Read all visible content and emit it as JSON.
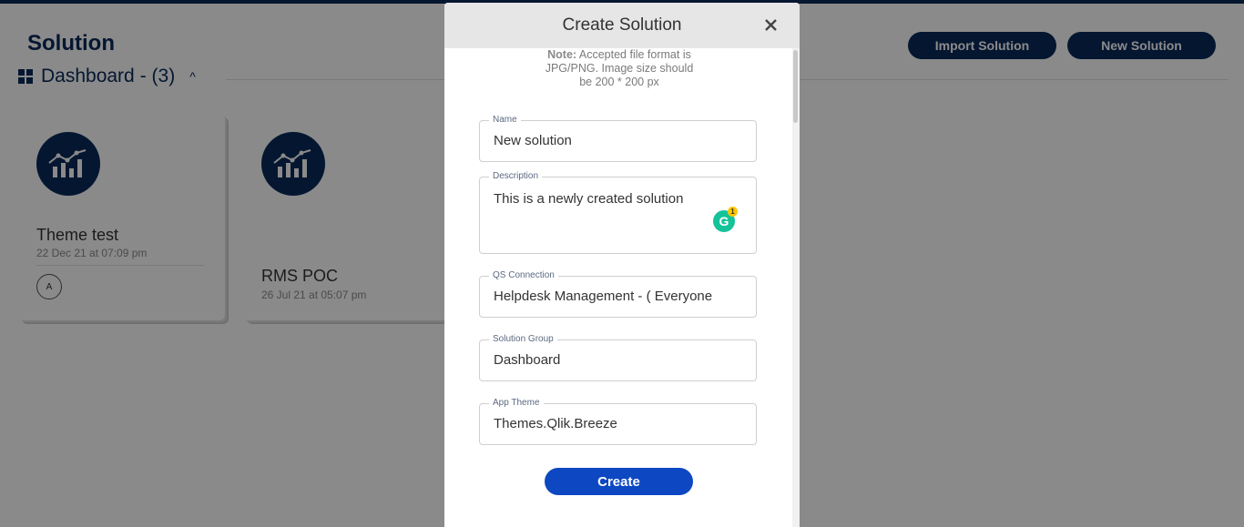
{
  "page": {
    "title": "Solution",
    "group_name": "Dashboard",
    "group_count": "- (3)",
    "import_button": "Import Solution",
    "new_button": "New Solution"
  },
  "cards": [
    {
      "title": "Theme test",
      "date": "22 Dec 21 at 07:09 pm",
      "user_initial": "A"
    },
    {
      "title": "RMS POC",
      "date": "26 Jul 21 at 05:07 pm"
    }
  ],
  "modal": {
    "title": "Create Solution",
    "note_label": "Note:",
    "note_text": "Accepted file format is JPG/PNG. Image size should be 200 * 200 px",
    "fields": {
      "name": {
        "label": "Name",
        "value": "New solution"
      },
      "description": {
        "label": "Description",
        "value": "This is a newly created solution"
      },
      "qs_connection": {
        "label": "QS Connection",
        "value": "Helpdesk Management - ( Everyone"
      },
      "solution_group": {
        "label": "Solution Group",
        "value": "Dashboard"
      },
      "app_theme": {
        "label": "App Theme",
        "value": "Themes.Qlik.Breeze"
      }
    },
    "grammarly_count": "1",
    "create_button": "Create"
  },
  "icons": {
    "grid": "grid-icon",
    "caret": "chevron-up-icon",
    "chart": "chart-icon",
    "close": "close-icon",
    "grammarly": "grammarly-icon"
  },
  "colors": {
    "brand_dark": "#0a2a5c",
    "primary": "#0d47c2",
    "overlay": "rgba(0,0,0,0.46)"
  }
}
